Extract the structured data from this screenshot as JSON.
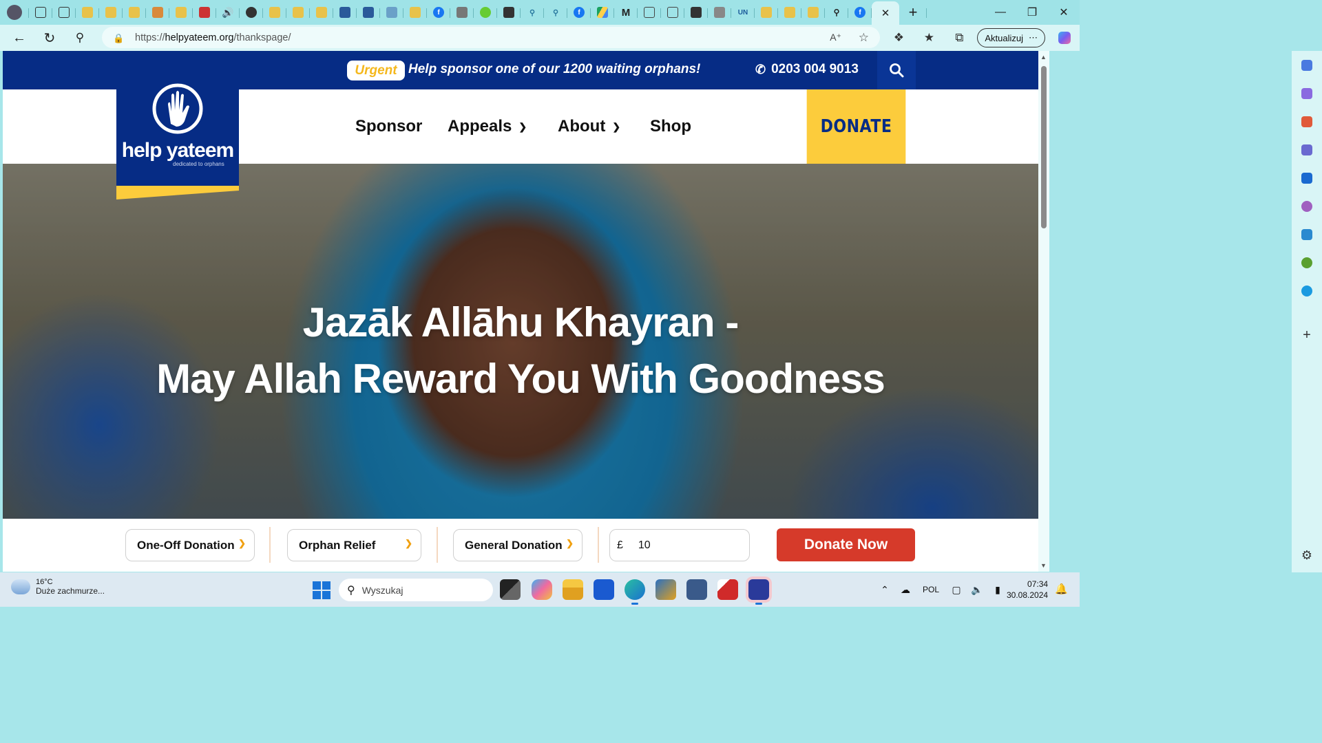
{
  "browser": {
    "tab_count_icons": [
      "profile-avatar",
      "workspaces",
      "tab-actions",
      "bird",
      "bird",
      "bird",
      "bird-red",
      "bird",
      "youtube",
      "speaker",
      "globe",
      "bird",
      "bird",
      "bird",
      "window",
      "window",
      "link",
      "bird",
      "facebook",
      "shield",
      "smile",
      "shield",
      "search",
      "search",
      "facebook",
      "drive",
      "m-logo",
      "doc",
      "doc",
      "square",
      "calendar",
      "un-logo",
      "bird",
      "bird",
      "bird",
      "search",
      "facebook"
    ],
    "address": {
      "scheme": "https://",
      "host": "helpyateem.org",
      "path": "/thankspage/"
    },
    "update_label": "Aktualizuj",
    "more_label": "⋯"
  },
  "site": {
    "urgent_label": "Urgent",
    "urgent_message": "Help sponsor one of our 1200 waiting orphans!",
    "phone": "0203 004 9013",
    "logo_brand": "help yateem",
    "logo_tagline": "dedicated to orphans",
    "nav": {
      "sponsor": "Sponsor",
      "appeals": "Appeals",
      "about": "About",
      "shop": "Shop"
    },
    "donate_label": "DONATE",
    "hero": {
      "line1": "Jazāk Allāhu Khayran -",
      "line2": "May Allah Reward You With Goodness"
    },
    "donation_bar": {
      "frequency": "One-Off Donation",
      "appeal": "Orphan Relief",
      "type": "General Donation",
      "currency": "£",
      "amount": "10",
      "button": "Donate Now"
    }
  },
  "taskbar": {
    "temperature": "16°C",
    "weather": "Duże zachmurze...",
    "search_placeholder": "Wyszukaj",
    "language": "POL",
    "time": "07:34",
    "date": "30.08.2024"
  },
  "colors": {
    "brand_navy": "#062c85",
    "brand_yellow": "#fccc3c",
    "donate_red": "#d63a2a",
    "browser_teal": "#9fe3e7"
  }
}
